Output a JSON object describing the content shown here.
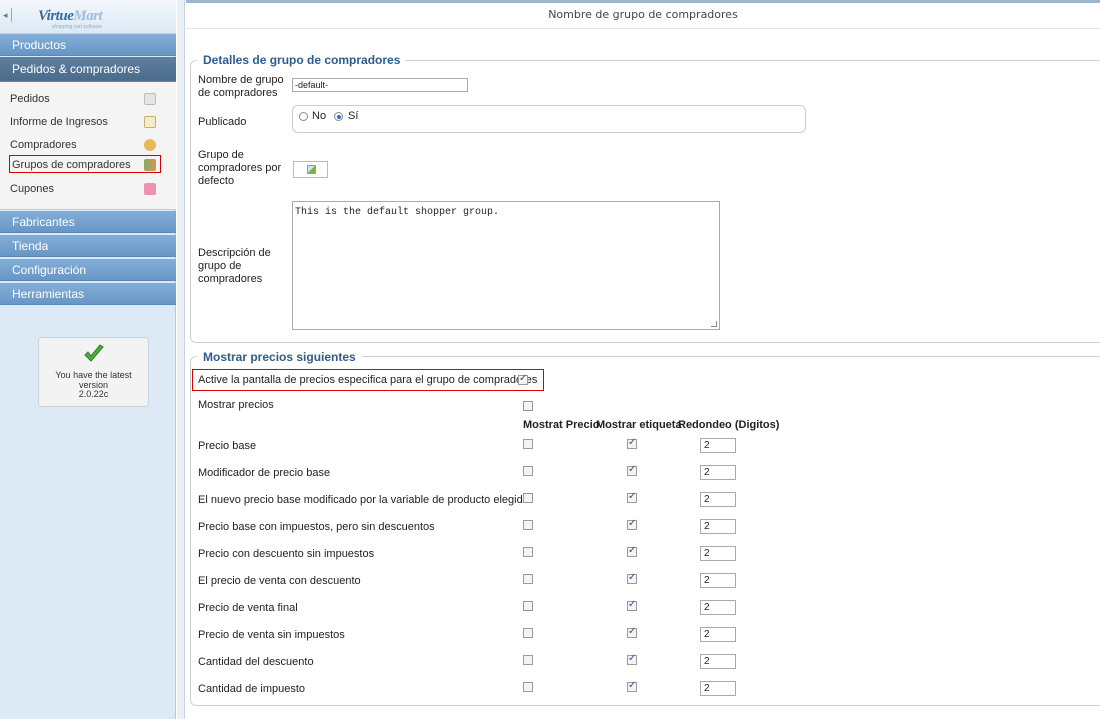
{
  "sidebar": {
    "logo_main": "Virtue",
    "logo_accent": "Mart",
    "logo_tagline": "shopping cart software",
    "menu": [
      {
        "label": "Productos"
      },
      {
        "label": "Pedidos & compradores"
      },
      {
        "label": "Fabricantes"
      },
      {
        "label": "Tienda"
      },
      {
        "label": "Configuración"
      },
      {
        "label": "Herramientas"
      }
    ],
    "submenu": [
      {
        "label": "Pedidos",
        "icon": "orders-icon"
      },
      {
        "label": "Informe de Ingresos",
        "icon": "report-icon"
      },
      {
        "label": "Compradores",
        "icon": "users-icon"
      },
      {
        "label": "Grupos de compradores",
        "icon": "shopper-groups-icon"
      },
      {
        "label": "Cupones",
        "icon": "coupon-icon"
      }
    ],
    "version": {
      "line1": "You have the latest",
      "line2": "version",
      "line3": "2.0.22c"
    }
  },
  "page": {
    "title": "Nombre de grupo de compradores"
  },
  "details": {
    "legend": "Detalles de grupo de compradores",
    "name_label": "Nombre de grupo de compradores",
    "name_value": "-default-",
    "published_label": "Publicado",
    "published_no": "No",
    "published_yes": "Sí",
    "published_value": "Sí",
    "default_label": "Grupo de compradores por defecto",
    "description_label": "Descripción de grupo de compradores",
    "description_value": "This is the default shopper group."
  },
  "prices": {
    "legend": "Mostrar precios siguientes",
    "custom_display_label": "Active la pantalla de precios especifica para el grupo de compradores",
    "custom_display_checked": true,
    "show_prices_label": "Mostrar precios",
    "show_prices_checked": false,
    "col_show": "Mostrat Precio",
    "col_label": "Mostrar etiqueta",
    "col_round": "Redondeo (Digitos)",
    "rows": [
      {
        "label": "Precio base",
        "show": false,
        "show_label": true,
        "round": "2"
      },
      {
        "label": "Modificador de precio base",
        "show": false,
        "show_label": true,
        "round": "2"
      },
      {
        "label": "El nuevo precio base modificado por la variable de producto elegida",
        "show": false,
        "show_label": true,
        "round": "2"
      },
      {
        "label": "Precio base con impuestos, pero sin descuentos",
        "show": false,
        "show_label": true,
        "round": "2"
      },
      {
        "label": "Precio con descuento sin impuestos",
        "show": false,
        "show_label": true,
        "round": "2"
      },
      {
        "label": "El precio de venta con descuento",
        "show": false,
        "show_label": true,
        "round": "2"
      },
      {
        "label": "Precio de venta final",
        "show": false,
        "show_label": true,
        "round": "2"
      },
      {
        "label": "Precio de venta sin impuestos",
        "show": false,
        "show_label": true,
        "round": "2"
      },
      {
        "label": "Cantidad del descuento",
        "show": false,
        "show_label": true,
        "round": "2"
      },
      {
        "label": "Cantidad de impuesto",
        "show": false,
        "show_label": true,
        "round": "2"
      }
    ]
  },
  "colors": {
    "accent": "#2d5c8a",
    "highlight": "#d80000",
    "menu": "#6796c6"
  }
}
